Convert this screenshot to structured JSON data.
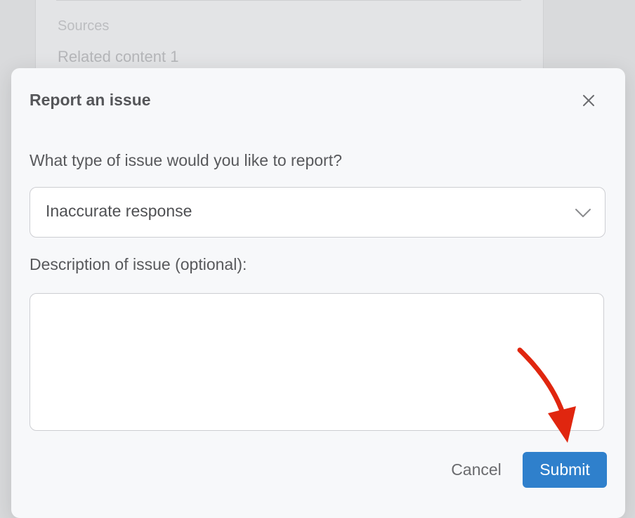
{
  "background": {
    "sources_label": "Sources",
    "related_item": "Related content 1"
  },
  "dialog": {
    "title": "Report an issue",
    "close_icon": "close-icon",
    "issue_type_label": "What type of issue would you like to report?",
    "issue_type_selected": "Inaccurate response",
    "description_label": "Description of issue (optional):",
    "description_value": "",
    "cancel_label": "Cancel",
    "submit_label": "Submit"
  },
  "colors": {
    "accent": "#2f80cc",
    "annotation": "#e0260f"
  },
  "annotation": {
    "icon": "red-arrow-icon",
    "points_to": "submit-button"
  }
}
